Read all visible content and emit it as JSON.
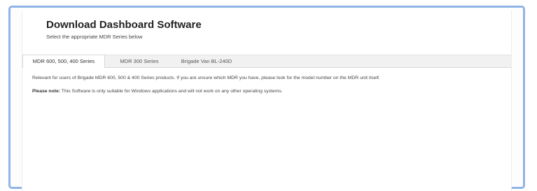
{
  "header": {
    "title": "Download Dashboard Software",
    "subtitle": "Select the appropriate MDR Series below"
  },
  "tabs": [
    {
      "label": "MDR 600, 500, 400 Series",
      "active": true
    },
    {
      "label": "MDR 300 Series",
      "active": false
    },
    {
      "label": "Brigade Van BL-240D",
      "active": false
    }
  ],
  "content": {
    "relevance_text": "Relevant for users of Brigade MDR 600, 500 & 400 Series products. If you are unsure which MDR you have, please look for the model number on the MDR unit itself.",
    "note_label": "Please note:",
    "note_text": " This Software is only suitable for Windows applications and will not work on any other operating systems."
  },
  "colors": {
    "frame_border": "#8fb4e6",
    "tab_bar": "#f1f1f1",
    "text": "#444444"
  }
}
